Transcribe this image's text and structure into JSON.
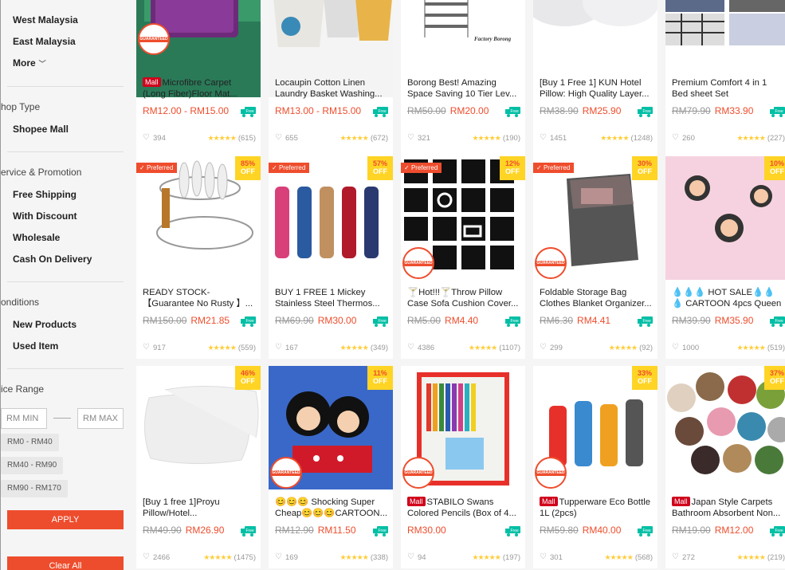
{
  "sidebar": {
    "locations": [
      "West Malaysia",
      "East Malaysia"
    ],
    "more_label": "More",
    "shop_type_heading": "hop Type",
    "shop_type_items": [
      "Shopee Mall"
    ],
    "service_heading": "ervice & Promotion",
    "service_items": [
      "Free Shipping",
      "With Discount",
      "Wholesale",
      "Cash On Delivery"
    ],
    "conditions_heading": "onditions",
    "condition_items": [
      "New Products",
      "Used Item"
    ],
    "price_heading": "ice Range",
    "min_placeholder": "RM MIN",
    "max_placeholder": "RM MAX",
    "price_chips": [
      "RM0 - RM40",
      "RM40 - RM90",
      "RM90 - RM170"
    ],
    "apply_label": "APPLY",
    "clear_label": "Clear All"
  },
  "colors": {
    "accent": "#ee4d2d",
    "mall": "#d0011b",
    "discount": "#ffd424",
    "free_ship": "#00bfa5"
  },
  "products": [
    {
      "title": "Microfibre Carpet (Long Fiber)Floor Mat...",
      "mall": "Mall",
      "price": "RM12.00 - RM15.00",
      "old_price": "",
      "likes": "394",
      "stars": "★★★★★",
      "reviews": "(615)",
      "preferred": "",
      "discount": "",
      "guaranteed": "GUARANTEED"
    },
    {
      "title": "Locaupin Cotton Linen Laundry Basket Washing...",
      "mall": "",
      "price": "RM13.00 - RM15.00",
      "old_price": "",
      "likes": "655",
      "stars": "★★★★★",
      "reviews": "(672)",
      "preferred": "",
      "discount": "",
      "guaranteed": ""
    },
    {
      "title": "Borong Best! Amazing Space Saving 10 Tier Lev...",
      "mall": "",
      "price": "RM20.00",
      "old_price": "RM50.00",
      "likes": "321",
      "stars": "★★★★★",
      "reviews": "(190)",
      "preferred": "",
      "discount": "",
      "guaranteed": "",
      "image_caption": "Factory Borong"
    },
    {
      "title": "[Buy 1 Free 1] KUN Hotel Pillow: High Quality Layer...",
      "mall": "",
      "price": "RM25.90",
      "old_price": "RM38.90",
      "likes": "1451",
      "stars": "★★★★★",
      "reviews": "(1248)",
      "preferred": "",
      "discount": "",
      "guaranteed": ""
    },
    {
      "title": "Premium Comfort 4 in 1 Bed sheet Set",
      "mall": "",
      "price": "RM33.90",
      "old_price": "RM79.90",
      "likes": "260",
      "stars": "★★★★★",
      "reviews": "(227)",
      "preferred": "",
      "discount": "",
      "guaranteed": ""
    },
    {
      "title": "READY STOCK-【Guarantee No Rusty 】...",
      "mall": "",
      "price": "RM21.85",
      "old_price": "RM150.00",
      "likes": "917",
      "stars": "★★★★★",
      "reviews": "(559)",
      "preferred": "Preferred",
      "discount": "85%",
      "guaranteed": ""
    },
    {
      "title": "BUY 1 FREE 1 Mickey Stainless Steel Thermos...",
      "mall": "",
      "price": "RM30.00",
      "old_price": "RM69.90",
      "likes": "167",
      "stars": "★★★★★",
      "reviews": "(349)",
      "preferred": "Preferred",
      "discount": "57%",
      "guaranteed": ""
    },
    {
      "title": "🍸Hot!!!🍸Throw Pillow Case Sofa Cushion Cover...",
      "mall": "",
      "price": "RM4.40",
      "old_price": "RM5.00",
      "likes": "4386",
      "stars": "★★★★★",
      "reviews": "(1107)",
      "preferred": "Preferred",
      "discount": "12%",
      "guaranteed": "GUARANTEED"
    },
    {
      "title": "Foldable Storage Bag Clothes Blanket Organizer...",
      "mall": "",
      "price": "RM4.41",
      "old_price": "RM6.30",
      "likes": "299",
      "stars": "★★★★★",
      "reviews": "(92)",
      "preferred": "Preferred",
      "discount": "30%",
      "guaranteed": "GUARANTEED"
    },
    {
      "title": "💧💧💧 HOT SALE💧💧💧 CARTOON 4pcs Queen si...",
      "mall": "",
      "price": "RM35.90",
      "old_price": "RM39.90",
      "likes": "1000",
      "stars": "★★★★★",
      "reviews": "(519)",
      "preferred": "",
      "discount": "10%",
      "guaranteed": ""
    },
    {
      "title": "[Buy 1 free 1]Proyu Pillow/Hotel...",
      "mall": "",
      "price": "RM26.90",
      "old_price": "RM49.90",
      "likes": "2466",
      "stars": "★★★★★",
      "reviews": "(1475)",
      "preferred": "",
      "discount": "46%",
      "guaranteed": ""
    },
    {
      "title": "😊😊😊 Shocking Super Cheap😊😊😊CARTOON...",
      "mall": "",
      "price": "RM11.50",
      "old_price": "RM12.90",
      "likes": "169",
      "stars": "★★★★★",
      "reviews": "(338)",
      "preferred": "",
      "discount": "11%",
      "guaranteed": "GUARANTEED"
    },
    {
      "title": "STABILO Swans Colored Pencils (Box of 4...",
      "mall": "Mall",
      "price": "RM30.00",
      "old_price": "",
      "likes": "94",
      "stars": "★★★★★",
      "reviews": "(197)",
      "preferred": "",
      "discount": "",
      "guaranteed": "GUARANTEED"
    },
    {
      "title": "Tupperware Eco Bottle 1L (2pcs)",
      "mall": "Mall",
      "price": "RM40.00",
      "old_price": "RM59.80",
      "likes": "301",
      "stars": "★★★★★",
      "reviews": "(568)",
      "preferred": "",
      "discount": "33%",
      "guaranteed": "GUARANTEED"
    },
    {
      "title": "Japan Style Carpets Bathroom Absorbent Non...",
      "mall": "Mall",
      "price": "RM12.00",
      "old_price": "RM19.00",
      "likes": "272",
      "stars": "★★★★★",
      "reviews": "(219)",
      "preferred": "",
      "discount": "37%",
      "guaranteed": ""
    }
  ],
  "discount_off_label": "OFF",
  "free_label": "Free"
}
